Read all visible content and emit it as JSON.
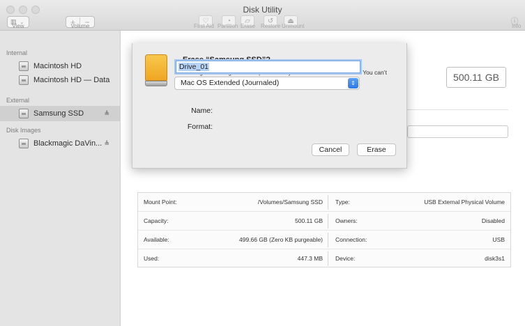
{
  "window": {
    "title": "Disk Utility"
  },
  "toolbar": {
    "view_label": "View",
    "volume_label": "Volume",
    "volume_add": "+",
    "volume_remove": "−",
    "first_aid_label": "First Aid",
    "partition_label": "Partition",
    "erase_label": "Erase",
    "restore_label": "Restore",
    "unmount_label": "Unmount",
    "info_label": "Info"
  },
  "sidebar": {
    "internal_header": "Internal",
    "external_header": "External",
    "disk_images_header": "Disk Images",
    "internal_items": [
      {
        "label": "Macintosh HD"
      },
      {
        "label": "Macintosh HD — Data"
      }
    ],
    "external_items": [
      {
        "label": "Samsung SSD",
        "eject": "≜"
      }
    ],
    "disk_image_items": [
      {
        "label": "Blackmagic DaVin...",
        "eject": "≜"
      }
    ]
  },
  "main": {
    "capacity_display": "500.11 GB"
  },
  "dialog": {
    "title": "Erase “Samsung SSD”?",
    "message": "Erasing “Samsung SSD” will permanently erase all data stored on it. You can’t undo this action.",
    "name_label": "Name:",
    "name_value": "Drive_01",
    "format_label": "Format:",
    "format_value": "Mac OS Extended (Journaled)",
    "cancel_label": "Cancel",
    "erase_label": "Erase"
  },
  "info": {
    "rows": [
      {
        "l1": "Mount Point:",
        "v1": "/Volumes/Samsung SSD",
        "l2": "Type:",
        "v2": "USB External Physical Volume"
      },
      {
        "l1": "Capacity:",
        "v1": "500.11 GB",
        "l2": "Owners:",
        "v2": "Disabled"
      },
      {
        "l1": "Available:",
        "v1": "499.66 GB (Zero KB purgeable)",
        "l2": "Connection:",
        "v2": "USB"
      },
      {
        "l1": "Used:",
        "v1": "447.3 MB",
        "l2": "Device:",
        "v2": "disk3s1"
      }
    ]
  },
  "colors": {
    "accent": "#2d79e6",
    "disk_icon": "#f0a623",
    "selection": "#d0d0d0"
  }
}
